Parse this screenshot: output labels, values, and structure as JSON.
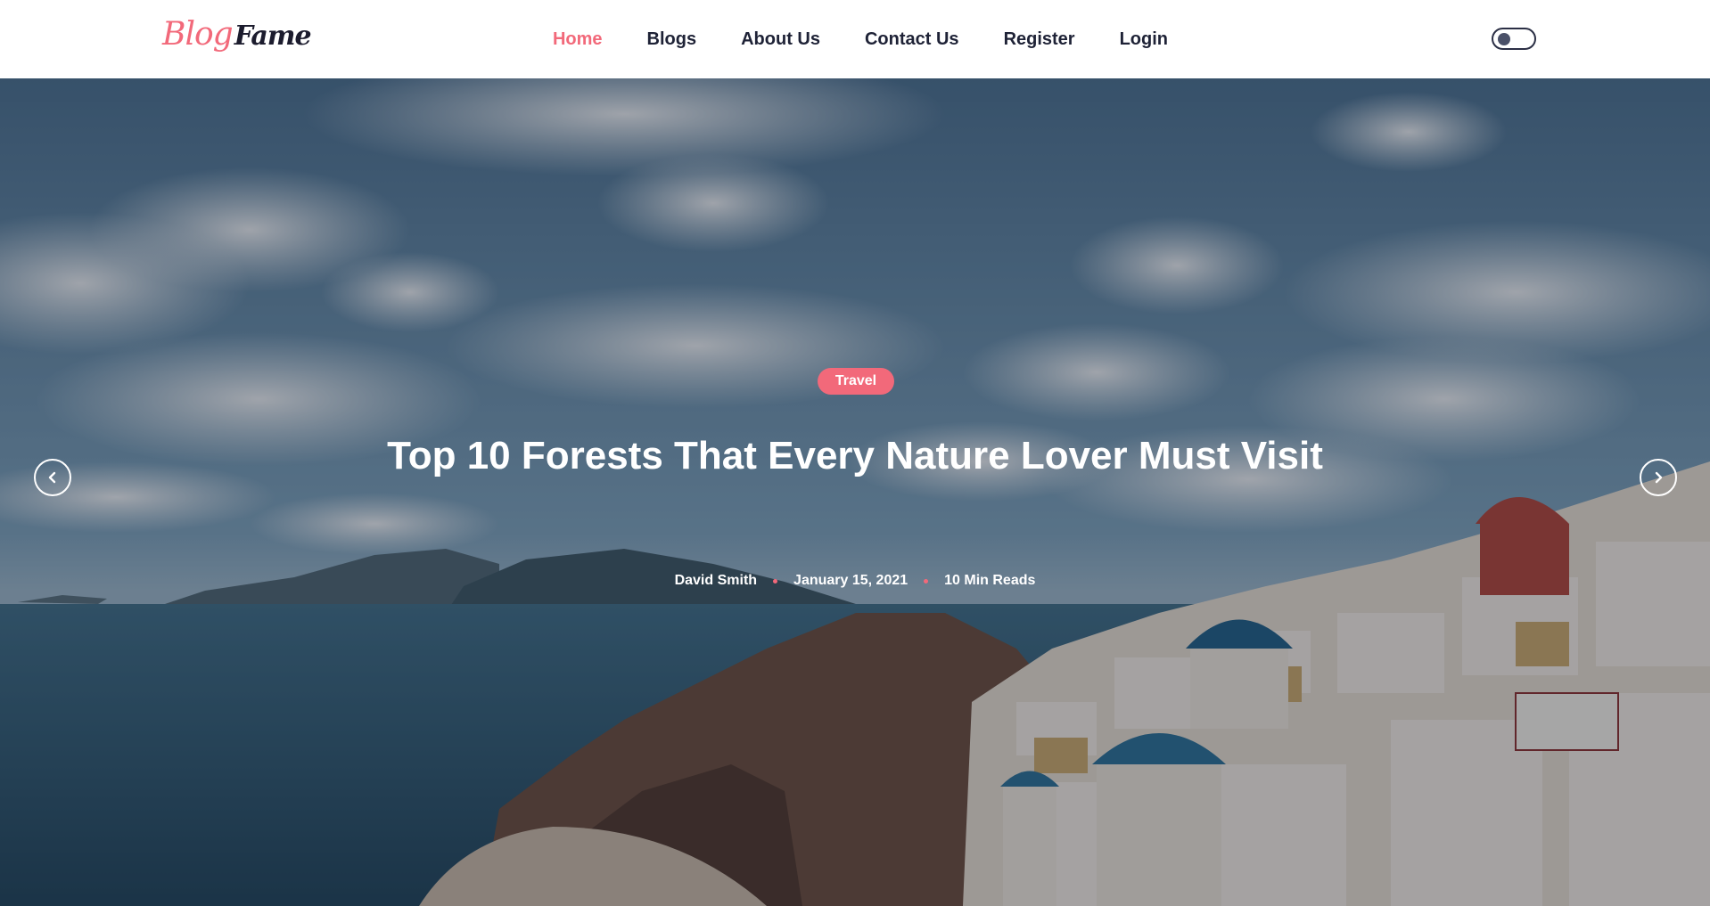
{
  "logo": {
    "part1": "Blog",
    "part2": "Fame"
  },
  "nav": {
    "items": [
      {
        "label": "Home",
        "active": true
      },
      {
        "label": "Blogs",
        "active": false
      },
      {
        "label": "About Us",
        "active": false
      },
      {
        "label": "Contact Us",
        "active": false
      },
      {
        "label": "Register",
        "active": false
      },
      {
        "label": "Login",
        "active": false
      }
    ]
  },
  "theme_toggle": {
    "icon": "toggle-switch-icon"
  },
  "hero": {
    "category": "Travel",
    "title": "Top 10 Forests That Every Nature Lover Must Visit",
    "author": "David Smith",
    "date": "January 15, 2021",
    "read_time": "10 Min Reads",
    "prev_icon": "chevron-left-icon",
    "next_icon": "chevron-right-icon"
  },
  "colors": {
    "accent": "#f2697a",
    "nav_text": "#1e2236",
    "hero_text": "#ffffff"
  }
}
